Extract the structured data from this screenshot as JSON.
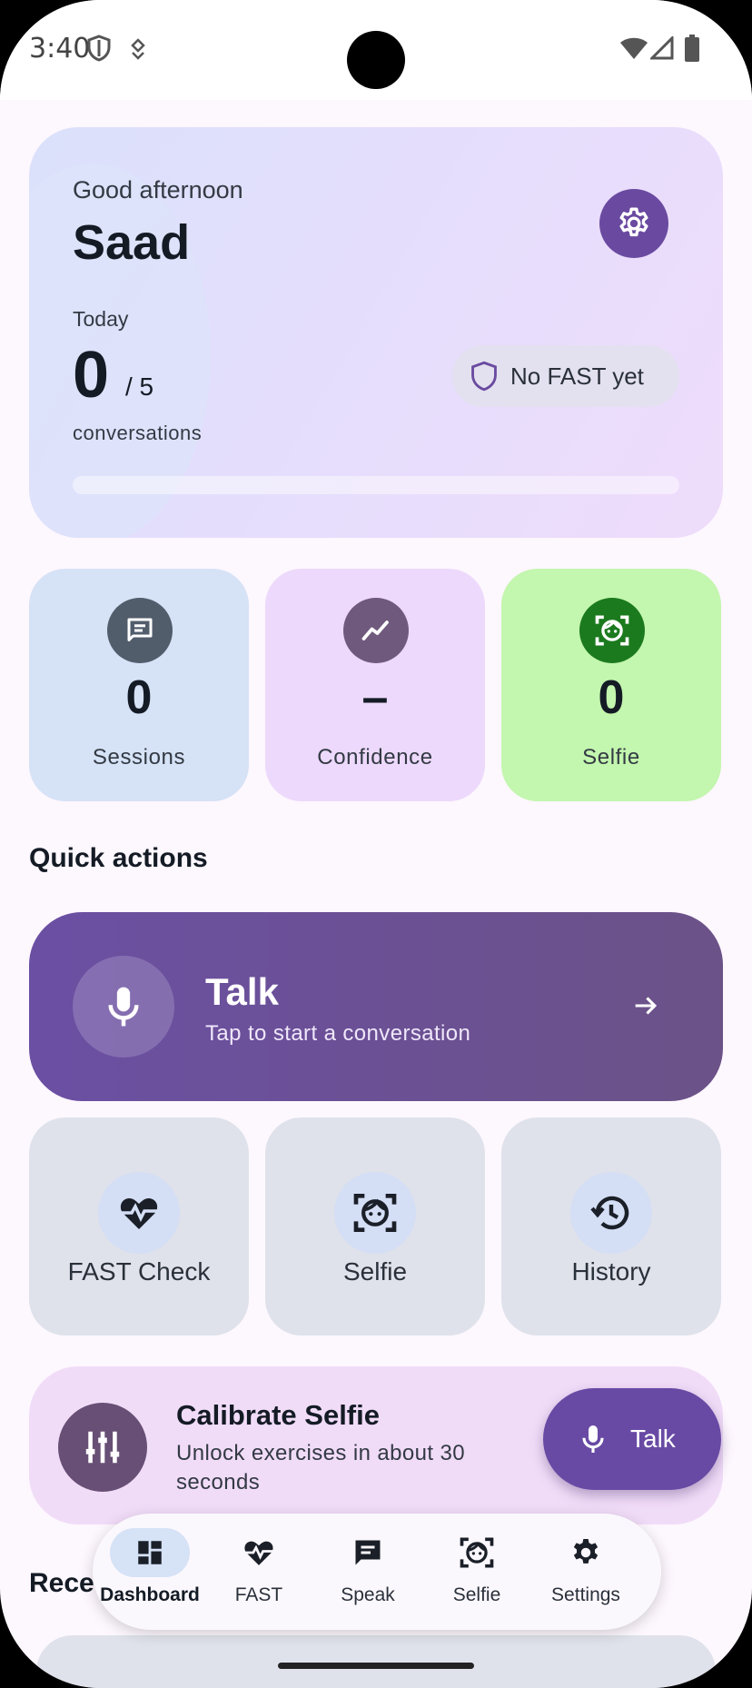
{
  "status_bar": {
    "time": "3:40"
  },
  "hero": {
    "greeting": "Good afternoon",
    "name": "Saad",
    "today_label": "Today",
    "count": "0",
    "goal": "/ 5",
    "unit": "conversations",
    "fast_chip": "No FAST yet",
    "progress_fraction": 0
  },
  "stats": [
    {
      "value": "0",
      "label": "Sessions",
      "color": "#d6e2f6",
      "icon_bg": "#525d6c"
    },
    {
      "value": "–",
      "label": "Confidence",
      "color": "#edd9fb",
      "icon_bg": "#6f5a7e"
    },
    {
      "value": "0",
      "label": "Selfie",
      "color": "#c3f6ae",
      "icon_bg": "#1b7a1e"
    }
  ],
  "quick_actions": {
    "title": "Quick actions",
    "talk": {
      "title": "Talk",
      "subtitle": "Tap to start a conversation"
    },
    "tiles": [
      {
        "label": "FAST Check",
        "icon": "heart-pulse-icon"
      },
      {
        "label": "Selfie",
        "icon": "face-scan-icon"
      },
      {
        "label": "History",
        "icon": "history-icon"
      }
    ]
  },
  "calibrate": {
    "title": "Calibrate Selfie",
    "subtitle": "Unlock exercises in about 30 seconds"
  },
  "fab": {
    "label": "Talk"
  },
  "recent": {
    "title": "Rece"
  },
  "nav": [
    {
      "label": "Dashboard",
      "icon": "dashboard-icon",
      "active": true
    },
    {
      "label": "FAST",
      "icon": "heart-pulse-icon",
      "active": false
    },
    {
      "label": "Speak",
      "icon": "chat-icon",
      "active": false
    },
    {
      "label": "Selfie",
      "icon": "face-scan-icon",
      "active": false
    },
    {
      "label": "Settings",
      "icon": "gear-icon",
      "active": false
    }
  ],
  "colors": {
    "accent": "#6a4aa0",
    "background": "#fdf7fe"
  }
}
